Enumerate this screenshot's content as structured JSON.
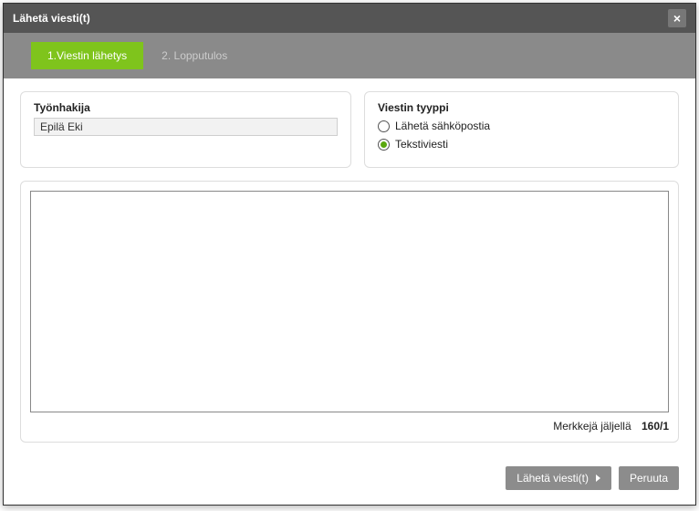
{
  "dialog": {
    "title": "Lähetä viesti(t)"
  },
  "tabs": {
    "step1": "1.Viestin lähetys",
    "step2": "2. Lopputulos"
  },
  "applicant": {
    "label": "Työnhakija",
    "value": "Epilä Eki"
  },
  "messageType": {
    "label": "Viestin tyyppi",
    "email": "Lähetä sähköpostia",
    "sms": "Tekstiviesti"
  },
  "message": {
    "value": ""
  },
  "counter": {
    "label": "Merkkejä jäljellä",
    "value": "160/1"
  },
  "buttons": {
    "send": "Lähetä viesti(t)",
    "cancel": "Peruuta"
  }
}
